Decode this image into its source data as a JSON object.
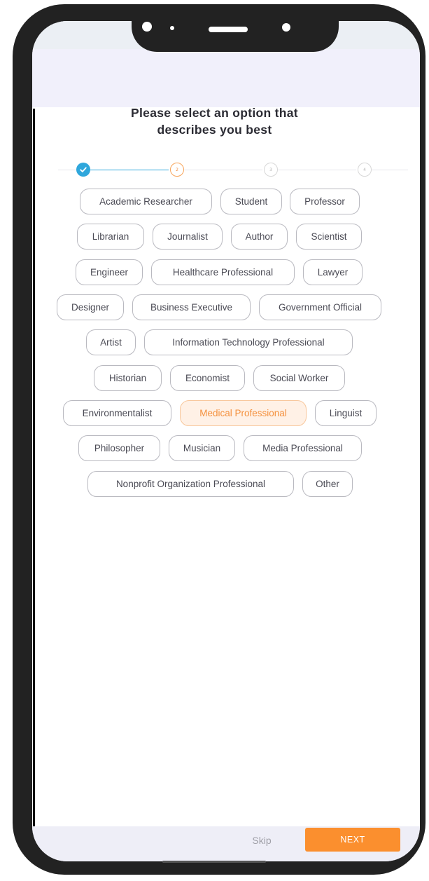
{
  "page": {
    "title_line1": "Please select an option that",
    "title_line2": "describes you best"
  },
  "stepper": {
    "steps": [
      {
        "label": "",
        "state": "done"
      },
      {
        "label": "2",
        "state": "active"
      },
      {
        "label": "3",
        "state": "todo"
      },
      {
        "label": "4",
        "state": "todo"
      }
    ],
    "done_color": "#2fa7dc",
    "active_color": "#f7a45a"
  },
  "options": [
    {
      "label": "Academic Researcher",
      "selected": false
    },
    {
      "label": "Student",
      "selected": false
    },
    {
      "label": "Professor",
      "selected": false
    },
    {
      "label": "Librarian",
      "selected": false
    },
    {
      "label": "Journalist",
      "selected": false
    },
    {
      "label": "Author",
      "selected": false
    },
    {
      "label": "Scientist",
      "selected": false
    },
    {
      "label": "Engineer",
      "selected": false
    },
    {
      "label": "Healthcare Professional",
      "selected": false
    },
    {
      "label": "Lawyer",
      "selected": false
    },
    {
      "label": "Designer",
      "selected": false
    },
    {
      "label": "Business Executive",
      "selected": false
    },
    {
      "label": "Government Official",
      "selected": false
    },
    {
      "label": "Artist",
      "selected": false
    },
    {
      "label": "Information Technology Professional",
      "selected": false
    },
    {
      "label": "Historian",
      "selected": false
    },
    {
      "label": "Economist",
      "selected": false
    },
    {
      "label": "Social Worker",
      "selected": false
    },
    {
      "label": "Environmentalist",
      "selected": false
    },
    {
      "label": "Medical Professional",
      "selected": true
    },
    {
      "label": "Linguist",
      "selected": false
    },
    {
      "label": "Philosopher",
      "selected": false
    },
    {
      "label": "Musician",
      "selected": false
    },
    {
      "label": "Media Professional",
      "selected": false
    },
    {
      "label": "Nonprofit Organization Professional",
      "selected": false
    },
    {
      "label": "Other",
      "selected": false
    }
  ],
  "footer": {
    "skip_label": "Skip",
    "next_label": "NEXT",
    "accent": "#fb8f2e"
  }
}
